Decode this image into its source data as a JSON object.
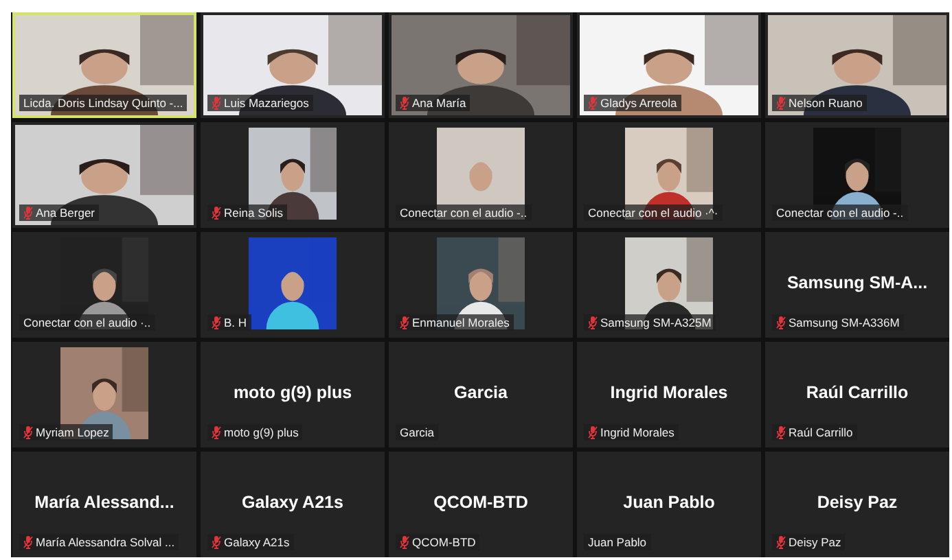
{
  "tiles": [
    {
      "label": "Licda. Doris Lindsay Quinto -...",
      "muted": false,
      "speaking": true,
      "kind": "video"
    },
    {
      "label": "Luis Mazariegos",
      "muted": true,
      "speaking": false,
      "kind": "video"
    },
    {
      "label": "Ana María",
      "muted": true,
      "speaking": false,
      "kind": "video"
    },
    {
      "label": "Gladys Arreola",
      "muted": true,
      "speaking": false,
      "kind": "video"
    },
    {
      "label": "Nelson Ruano",
      "muted": true,
      "speaking": false,
      "kind": "video"
    },
    {
      "label": "Ana Berger",
      "muted": true,
      "speaking": false,
      "kind": "video"
    },
    {
      "label": "Reina Solis",
      "muted": true,
      "speaking": false,
      "kind": "portrait"
    },
    {
      "label": "Conectar con el audio -..",
      "muted": false,
      "speaking": false,
      "kind": "portrait"
    },
    {
      "label": "Conectar con el audio ·^·",
      "muted": false,
      "speaking": false,
      "kind": "portrait"
    },
    {
      "label": "Conectar con el audio -..",
      "muted": false,
      "speaking": false,
      "kind": "portrait"
    },
    {
      "label": "Conectar con el audio ·..",
      "muted": false,
      "speaking": false,
      "kind": "portrait"
    },
    {
      "label": "B. H",
      "muted": true,
      "speaking": false,
      "kind": "portrait"
    },
    {
      "label": "Enmanuel Morales",
      "muted": true,
      "speaking": false,
      "kind": "portrait"
    },
    {
      "label": "Samsung SM-A325M",
      "muted": true,
      "speaking": false,
      "kind": "portrait"
    },
    {
      "label": "Samsung SM-A336M",
      "muted": true,
      "speaking": false,
      "kind": "name",
      "display_name": "Samsung  SM-A..."
    },
    {
      "label": "Myriam Lopez",
      "muted": true,
      "speaking": false,
      "kind": "portrait"
    },
    {
      "label": "moto g(9) plus",
      "muted": true,
      "speaking": false,
      "kind": "name",
      "display_name": "moto g(9) plus"
    },
    {
      "label": "Garcia",
      "muted": false,
      "speaking": false,
      "kind": "name",
      "display_name": "Garcia"
    },
    {
      "label": "Ingrid  Morales",
      "muted": true,
      "speaking": false,
      "kind": "name",
      "display_name": "Ingrid  Morales"
    },
    {
      "label": "Raúl Carrillo",
      "muted": true,
      "speaking": false,
      "kind": "name",
      "display_name": "Raúl Carrillo"
    },
    {
      "label": "María Alessandra Solval ...",
      "muted": true,
      "speaking": false,
      "kind": "name",
      "display_name": "María  Alessand..."
    },
    {
      "label": "Galaxy A21s",
      "muted": true,
      "speaking": false,
      "kind": "name",
      "display_name": "Galaxy A21s"
    },
    {
      "label": "QCOM-BTD",
      "muted": true,
      "speaking": false,
      "kind": "name",
      "display_name": "QCOM-BTD"
    },
    {
      "label": "Juan Pablo",
      "muted": false,
      "speaking": false,
      "kind": "name",
      "display_name": "Juan Pablo"
    },
    {
      "label": "Deisy Paz",
      "muted": true,
      "speaking": false,
      "kind": "name",
      "display_name": "Deisy Paz"
    }
  ]
}
